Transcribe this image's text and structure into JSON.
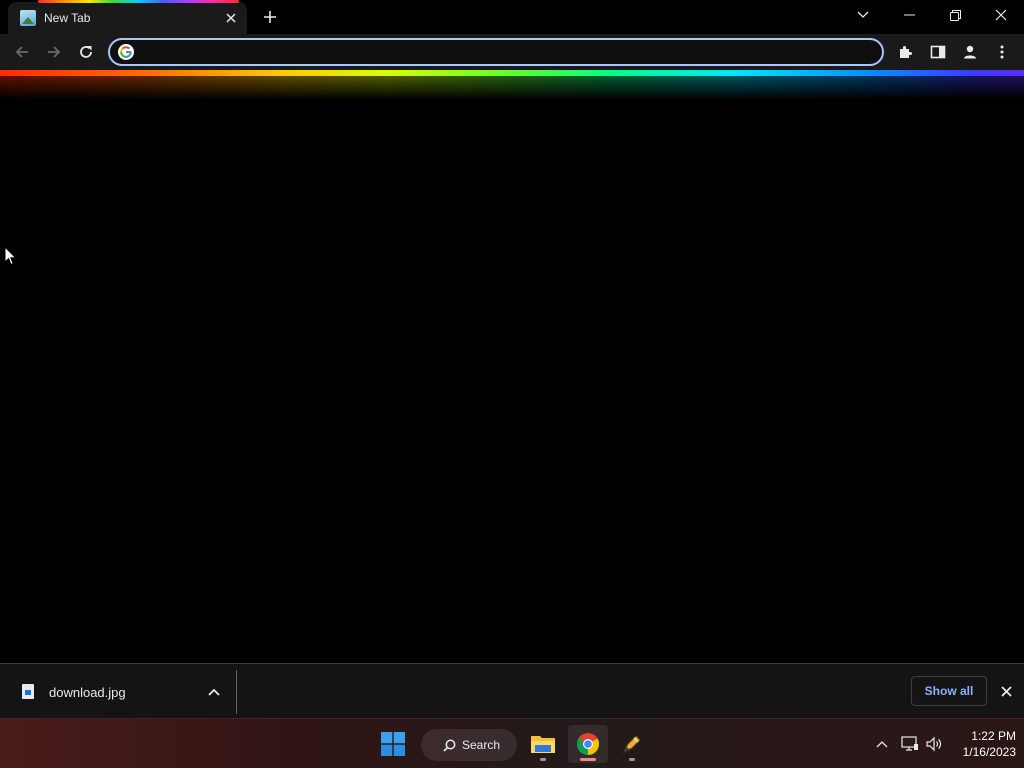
{
  "browser": {
    "tab": {
      "title": "New Tab"
    },
    "omnibox": {
      "value": "",
      "placeholder": ""
    }
  },
  "downloads": {
    "item": {
      "filename": "download.jpg"
    },
    "show_all_label": "Show all"
  },
  "taskbar": {
    "search_label": "Search",
    "clock": {
      "time": "1:22 PM",
      "date": "1/16/2023"
    }
  },
  "icons": {
    "tab_favicon": "image-icon",
    "omnibox": "google-icon",
    "apps": [
      "windows-start-icon",
      "file-explorer-icon",
      "chrome-icon",
      "pen-tool-icon"
    ]
  },
  "colors": {
    "omnibox_border": "#a8c7fa",
    "show_all_text": "#8ab4f8",
    "background": "#000000"
  }
}
